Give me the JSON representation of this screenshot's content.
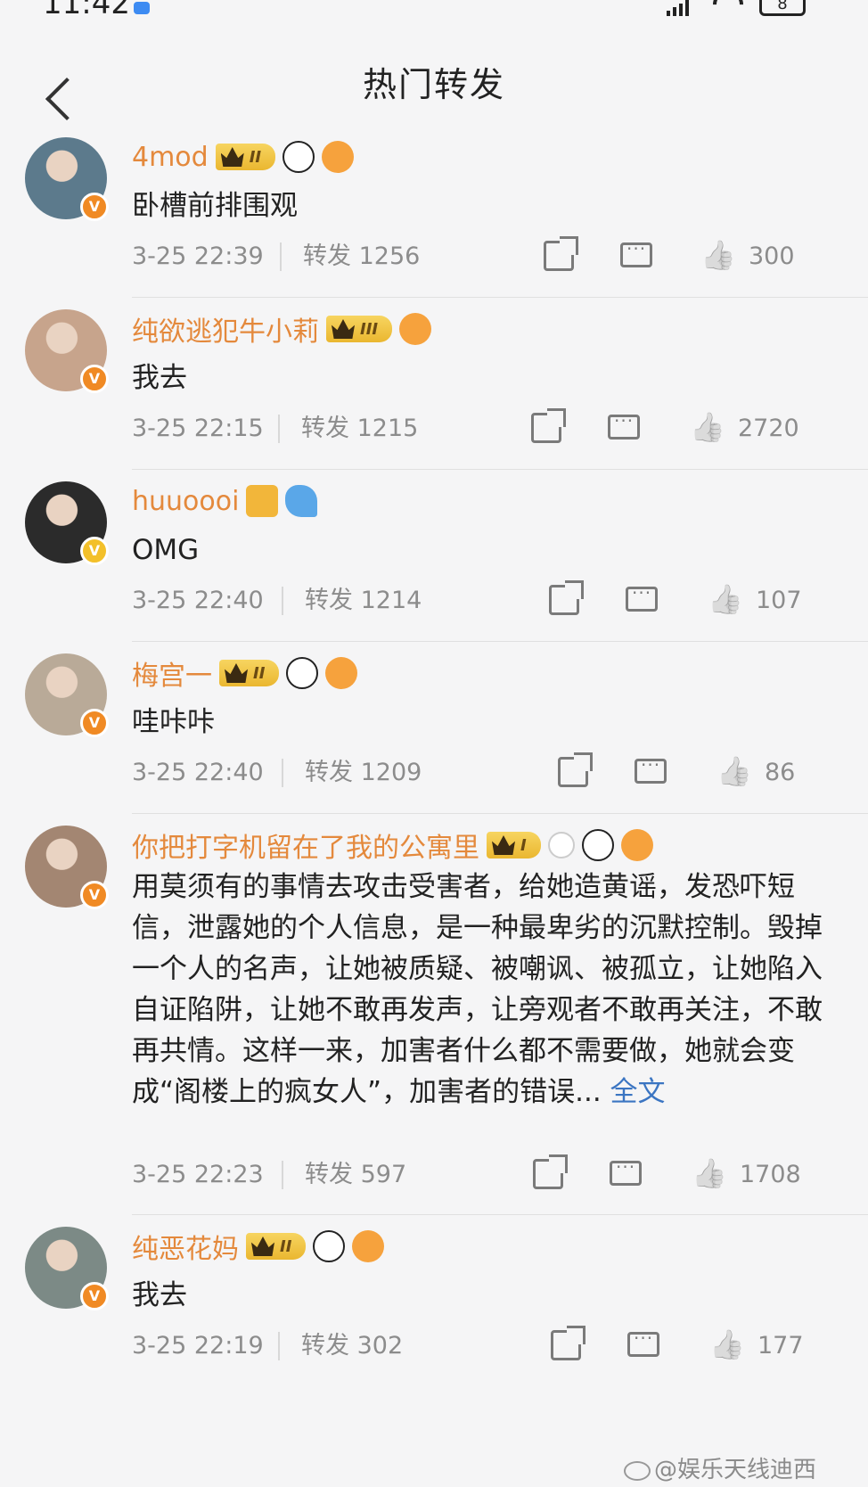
{
  "status_bar": {
    "time": "11:42",
    "battery": "8"
  },
  "header": {
    "title": "热门转发"
  },
  "items": [
    {
      "username": "4mod",
      "badge": "II",
      "emojis": [
        "panda",
        "fish"
      ],
      "content": "卧槽前排围观",
      "time": "3-25 22:39",
      "repost": "转发 1256",
      "likes": "300",
      "avatar_color": "#5c7a8c",
      "v_color": "orange"
    },
    {
      "username": "纯欲逃犯牛小莉",
      "badge": "III",
      "emojis": [
        "fish"
      ],
      "content": "我去",
      "time": "3-25 22:15",
      "repost": "转发 1215",
      "likes": "2720",
      "avatar_color": "#c7a48c",
      "v_color": "orange"
    },
    {
      "username": "huuoooi",
      "badge": "",
      "emojis": [
        "crown2",
        "shark"
      ],
      "content": "OMG",
      "time": "3-25 22:40",
      "repost": "转发 1214",
      "likes": "107",
      "avatar_color": "#2b2b2b",
      "v_color": "gold"
    },
    {
      "username": "梅宫一",
      "badge": "II",
      "emojis": [
        "panda",
        "fish"
      ],
      "content": "哇咔咔",
      "time": "3-25 22:40",
      "repost": "转发 1209",
      "likes": "86",
      "avatar_color": "#b9aa98",
      "v_color": "orange"
    },
    {
      "username": "你把打字机留在了我的公寓里",
      "badge": "I",
      "emojis": [
        "bunny",
        "panda",
        "fish"
      ],
      "content": "用莫须有的事情去攻击受害者，给她造黄谣，发恐吓短信，泄露她的个人信息，是一种最卑劣的沉默控制。毁掉一个人的名声，让她被质疑、被嘲讽、被孤立，让她陷入自证陷阱，让她不敢再发声，让旁观者不敢再关注，不敢再共情。这样一来，加害者什么都不需要做，她就会变成“阁楼上的疯女人”，加害者的错误...",
      "more": "全文",
      "time": "3-25 22:23",
      "repost": "转发 597",
      "likes": "1708",
      "avatar_color": "#a38672",
      "v_color": "orange"
    },
    {
      "username": "纯恶花妈",
      "badge": "II",
      "emojis": [
        "panda",
        "fish"
      ],
      "content": "我去",
      "time": "3-25 22:19",
      "repost": "转发 302",
      "likes": "177",
      "avatar_color": "#7c8a86",
      "v_color": "orange"
    }
  ],
  "watermark": "@娱乐天线迪西"
}
